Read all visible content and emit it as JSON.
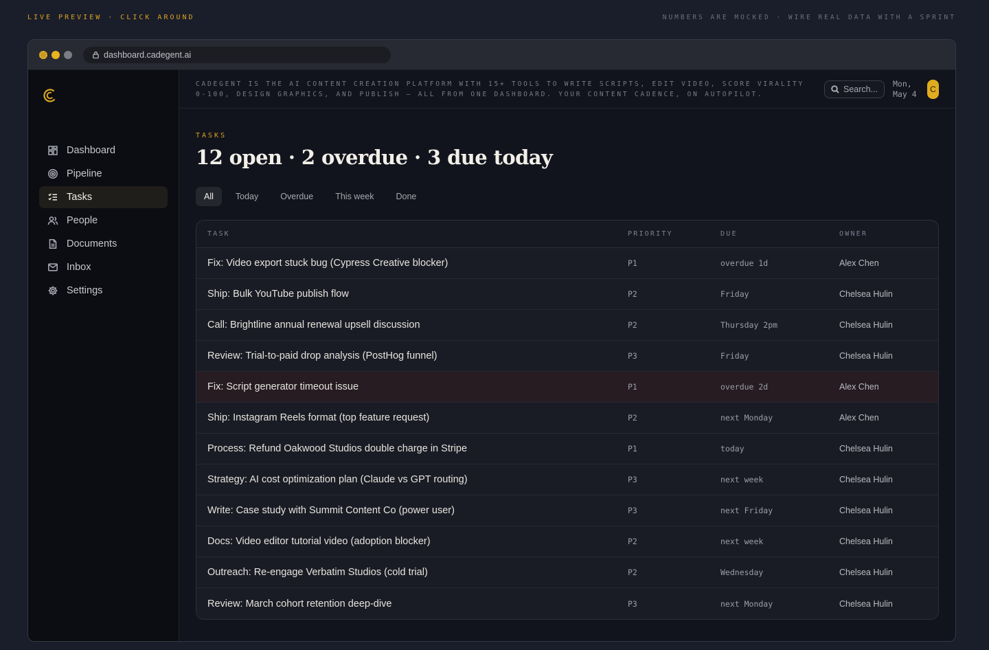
{
  "topbar": {
    "left": "Live preview · click around",
    "right": "Numbers are mocked · wire real data with a sprint"
  },
  "browser": {
    "url": "dashboard.cadegent.ai"
  },
  "sidebar": {
    "items": [
      {
        "label": "Dashboard",
        "icon": "dashboard-icon",
        "active": false
      },
      {
        "label": "Pipeline",
        "icon": "target-icon",
        "active": false
      },
      {
        "label": "Tasks",
        "icon": "checklist-icon",
        "active": true
      },
      {
        "label": "People",
        "icon": "people-icon",
        "active": false
      },
      {
        "label": "Documents",
        "icon": "document-icon",
        "active": false
      },
      {
        "label": "Inbox",
        "icon": "mail-icon",
        "active": false
      },
      {
        "label": "Settings",
        "icon": "gear-icon",
        "active": false
      }
    ]
  },
  "header": {
    "tagline": "Cadegent is the AI content creation platform with 15+ tools to write scripts, edit video, score virality 0-100, design graphics, and publish — all from one dashboard. Your content cadence, on autopilot.",
    "search_placeholder": "Search...",
    "date_line1": "Mon,",
    "date_line2": "May 4",
    "avatar": "C"
  },
  "page": {
    "eyebrow": "Tasks",
    "title": "12 open · 2 overdue · 3 due today",
    "filters": [
      "All",
      "Today",
      "Overdue",
      "This week",
      "Done"
    ],
    "active_filter": "All"
  },
  "table": {
    "columns": [
      "TASK",
      "PRIORITY",
      "DUE",
      "OWNER"
    ],
    "rows": [
      {
        "task": "Fix: Video export stuck bug (Cypress Creative blocker)",
        "priority": "P1",
        "due": "overdue 1d",
        "owner": "Alex Chen"
      },
      {
        "task": "Ship: Bulk YouTube publish flow",
        "priority": "P2",
        "due": "Friday",
        "owner": "Chelsea Hulin"
      },
      {
        "task": "Call: Brightline annual renewal upsell discussion",
        "priority": "P2",
        "due": "Thursday 2pm",
        "owner": "Chelsea Hulin"
      },
      {
        "task": "Review: Trial-to-paid drop analysis (PostHog funnel)",
        "priority": "P3",
        "due": "Friday",
        "owner": "Chelsea Hulin"
      },
      {
        "task": "Fix: Script generator timeout issue",
        "priority": "P1",
        "due": "overdue 2d",
        "owner": "Alex Chen"
      },
      {
        "task": "Ship: Instagram Reels format (top feature request)",
        "priority": "P2",
        "due": "next Monday",
        "owner": "Alex Chen"
      },
      {
        "task": "Process: Refund Oakwood Studios double charge in Stripe",
        "priority": "P1",
        "due": "today",
        "owner": "Chelsea Hulin"
      },
      {
        "task": "Strategy: AI cost optimization plan (Claude vs GPT routing)",
        "priority": "P3",
        "due": "next week",
        "owner": "Chelsea Hulin"
      },
      {
        "task": "Write: Case study with Summit Content Co (power user)",
        "priority": "P3",
        "due": "next Friday",
        "owner": "Chelsea Hulin"
      },
      {
        "task": "Docs: Video editor tutorial video (adoption blocker)",
        "priority": "P2",
        "due": "next week",
        "owner": "Chelsea Hulin"
      },
      {
        "task": "Outreach: Re-engage Verbatim Studios (cold trial)",
        "priority": "P2",
        "due": "Wednesday",
        "owner": "Chelsea Hulin"
      },
      {
        "task": "Review: March cohort retention deep-dive",
        "priority": "P3",
        "due": "next Monday",
        "owner": "Chelsea Hulin"
      }
    ]
  },
  "colors": {
    "accent": "#d9a521",
    "background": "#12141d",
    "sidebar": "#0c0d12"
  }
}
